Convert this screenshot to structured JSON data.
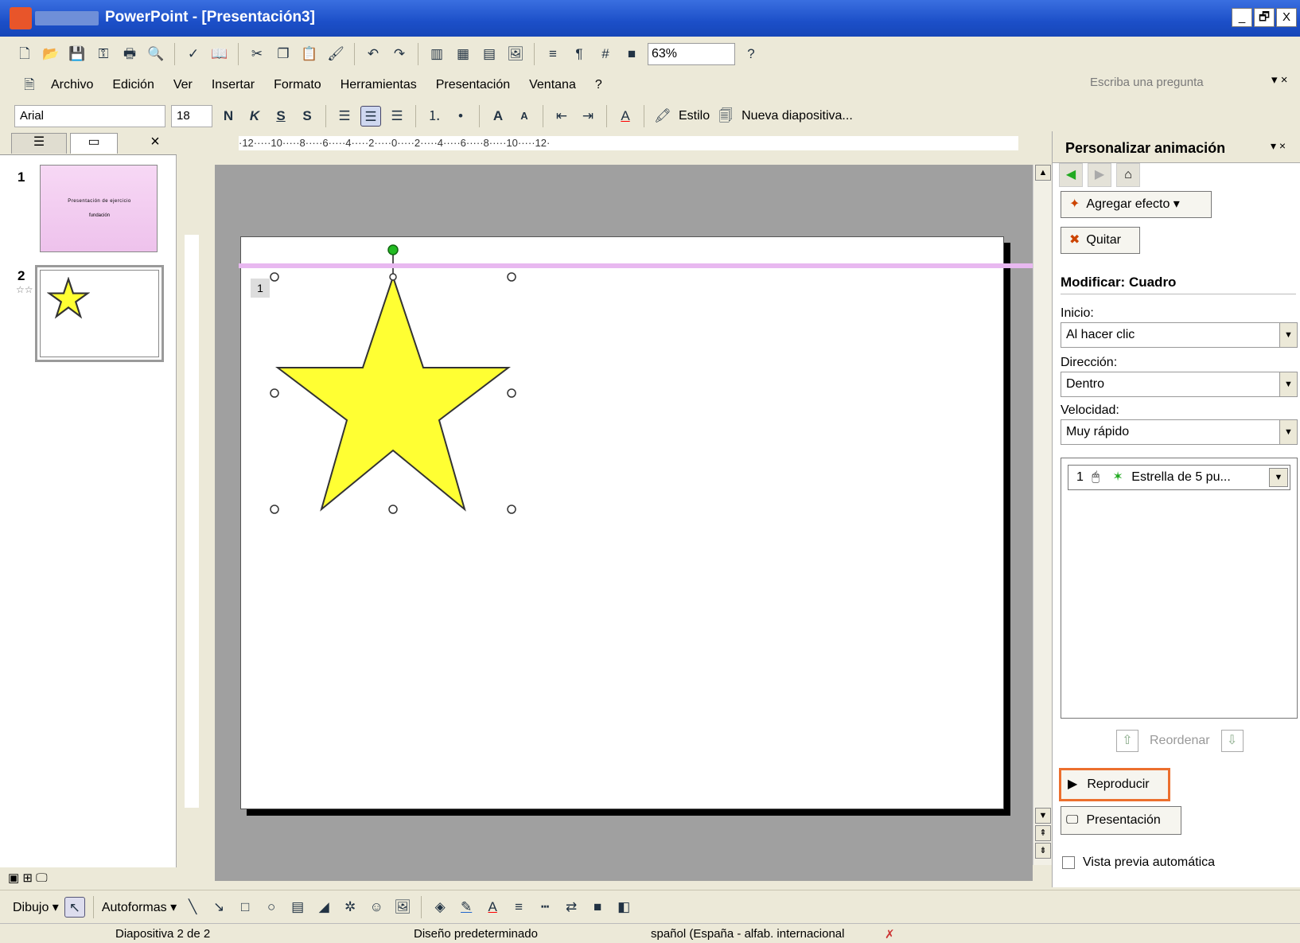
{
  "app": {
    "title": "PowerPoint - [Presentación3]",
    "win_min": "_",
    "win_max": "🗗",
    "win_close": "X"
  },
  "standard_toolbar": {
    "zoom": "63%"
  },
  "menu": {
    "items": [
      "Archivo",
      "Edición",
      "Ver",
      "Insertar",
      "Formato",
      "Herramientas",
      "Presentación",
      "Ventana",
      "?"
    ],
    "ask_placeholder": "Escriba una pregunta"
  },
  "format_toolbar": {
    "font": "Arial",
    "size": "18",
    "bold": "N",
    "italic": "K",
    "underline": "S",
    "shadow": "S",
    "grow": "A",
    "shrink": "A",
    "style_label": "Estilo",
    "new_slide_label": "Nueva diapositiva..."
  },
  "left_panel": {
    "slide1_num": "1",
    "slide1_title": "Presentación de ejercicio",
    "slide1_subtitle": "fundación",
    "slide2_num": "2",
    "close": "×"
  },
  "ruler": {
    "h": "·12·····10·····8·····6·····4·····2·····0·····2·····4·····6·····8·····10·····12·"
  },
  "slide": {
    "anim_tag": "1"
  },
  "task_pane": {
    "title": "Personalizar animación",
    "add_effect": "Agregar efecto",
    "remove": "Quitar",
    "modify_title": "Modificar: Cuadro",
    "start_label": "Inicio:",
    "start_value": "Al hacer clic",
    "direction_label": "Dirección:",
    "direction_value": "Dentro",
    "speed_label": "Velocidad:",
    "speed_value": "Muy rápido",
    "list_item_num": "1",
    "list_item_label": "Estrella de 5 pu...",
    "reorder": "Reordenar",
    "play": "Reproducir",
    "slideshow": "Presentación",
    "auto_preview": "Vista previa automática"
  },
  "draw_toolbar": {
    "draw": "Dibujo",
    "autoshapes": "Autoformas"
  },
  "status": {
    "slide": "Diapositiva 2 de 2",
    "design": "Diseño predeterminado",
    "language": "spañol (España - alfab. internacional"
  },
  "colors": {
    "star_fill": "#ffff33",
    "thumb_pink": "#f0c8ee",
    "highlight": "#ec6f2e",
    "motion_path": "#e8b8f0"
  }
}
